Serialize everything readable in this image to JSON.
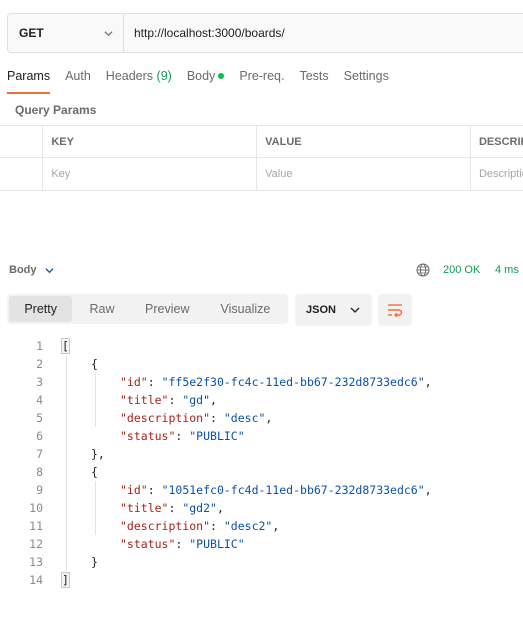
{
  "request": {
    "method": "GET",
    "url": "http://localhost:3000/boards/",
    "tabs": [
      {
        "label": "Params"
      },
      {
        "label": "Auth"
      },
      {
        "label": "Headers",
        "count": "(9)"
      },
      {
        "label": "Body"
      },
      {
        "label": "Pre-req."
      },
      {
        "label": "Tests"
      },
      {
        "label": "Settings"
      }
    ],
    "query_params_title": "Query Params",
    "table": {
      "headers": [
        "KEY",
        "VALUE",
        "DESCRIPTION"
      ],
      "placeholders": [
        "Key",
        "Value",
        "Description"
      ]
    }
  },
  "response": {
    "body_label": "Body",
    "status": "200 OK",
    "time": "4 ms",
    "view_tabs": [
      "Pretty",
      "Raw",
      "Preview",
      "Visualize"
    ],
    "format": "JSON",
    "code_lines": [
      {
        "n": "1",
        "tokens": [
          {
            "t": "p",
            "v": "[",
            "hl": true
          }
        ],
        "indent": 0
      },
      {
        "n": "2",
        "tokens": [
          {
            "t": "p",
            "v": "{"
          }
        ],
        "indent": 1
      },
      {
        "n": "3",
        "tokens": [
          {
            "t": "k",
            "v": "\"id\""
          },
          {
            "t": "p",
            "v": ": "
          },
          {
            "t": "s",
            "v": "\"ff5e2f30-fc4c-11ed-bb67-232d8733edc6\""
          },
          {
            "t": "p",
            "v": ","
          }
        ],
        "indent": 2
      },
      {
        "n": "4",
        "tokens": [
          {
            "t": "k",
            "v": "\"title\""
          },
          {
            "t": "p",
            "v": ": "
          },
          {
            "t": "s",
            "v": "\"gd\""
          },
          {
            "t": "p",
            "v": ","
          }
        ],
        "indent": 2
      },
      {
        "n": "5",
        "tokens": [
          {
            "t": "k",
            "v": "\"description\""
          },
          {
            "t": "p",
            "v": ": "
          },
          {
            "t": "s",
            "v": "\"desc\""
          },
          {
            "t": "p",
            "v": ","
          }
        ],
        "indent": 2
      },
      {
        "n": "6",
        "tokens": [
          {
            "t": "k",
            "v": "\"status\""
          },
          {
            "t": "p",
            "v": ": "
          },
          {
            "t": "s",
            "v": "\"PUBLIC\""
          }
        ],
        "indent": 2
      },
      {
        "n": "7",
        "tokens": [
          {
            "t": "p",
            "v": "},"
          }
        ],
        "indent": 1
      },
      {
        "n": "8",
        "tokens": [
          {
            "t": "p",
            "v": "{"
          }
        ],
        "indent": 1
      },
      {
        "n": "9",
        "tokens": [
          {
            "t": "k",
            "v": "\"id\""
          },
          {
            "t": "p",
            "v": ": "
          },
          {
            "t": "s",
            "v": "\"1051efc0-fc4d-11ed-bb67-232d8733edc6\""
          },
          {
            "t": "p",
            "v": ","
          }
        ],
        "indent": 2
      },
      {
        "n": "10",
        "tokens": [
          {
            "t": "k",
            "v": "\"title\""
          },
          {
            "t": "p",
            "v": ": "
          },
          {
            "t": "s",
            "v": "\"gd2\""
          },
          {
            "t": "p",
            "v": ","
          }
        ],
        "indent": 2
      },
      {
        "n": "11",
        "tokens": [
          {
            "t": "k",
            "v": "\"description\""
          },
          {
            "t": "p",
            "v": ": "
          },
          {
            "t": "s",
            "v": "\"desc2\""
          },
          {
            "t": "p",
            "v": ","
          }
        ],
        "indent": 2
      },
      {
        "n": "12",
        "tokens": [
          {
            "t": "k",
            "v": "\"status\""
          },
          {
            "t": "p",
            "v": ": "
          },
          {
            "t": "s",
            "v": "\"PUBLIC\""
          }
        ],
        "indent": 2
      },
      {
        "n": "13",
        "tokens": [
          {
            "t": "p",
            "v": "}"
          }
        ],
        "indent": 1
      },
      {
        "n": "14",
        "tokens": [
          {
            "t": "p",
            "v": "]",
            "hl": true
          }
        ],
        "indent": 0
      }
    ]
  },
  "colors": {
    "accent": "#f26b3a",
    "status_green": "#0d9b53",
    "json_key": "#a5241c",
    "json_string": "#0a51a8"
  },
  "icons": {
    "method_dropdown": "chevron-down-icon",
    "body_dropdown": "chevron-down-icon",
    "network": "globe-icon",
    "format_dropdown": "chevron-down-icon",
    "wrap": "wrap-lines-icon"
  }
}
